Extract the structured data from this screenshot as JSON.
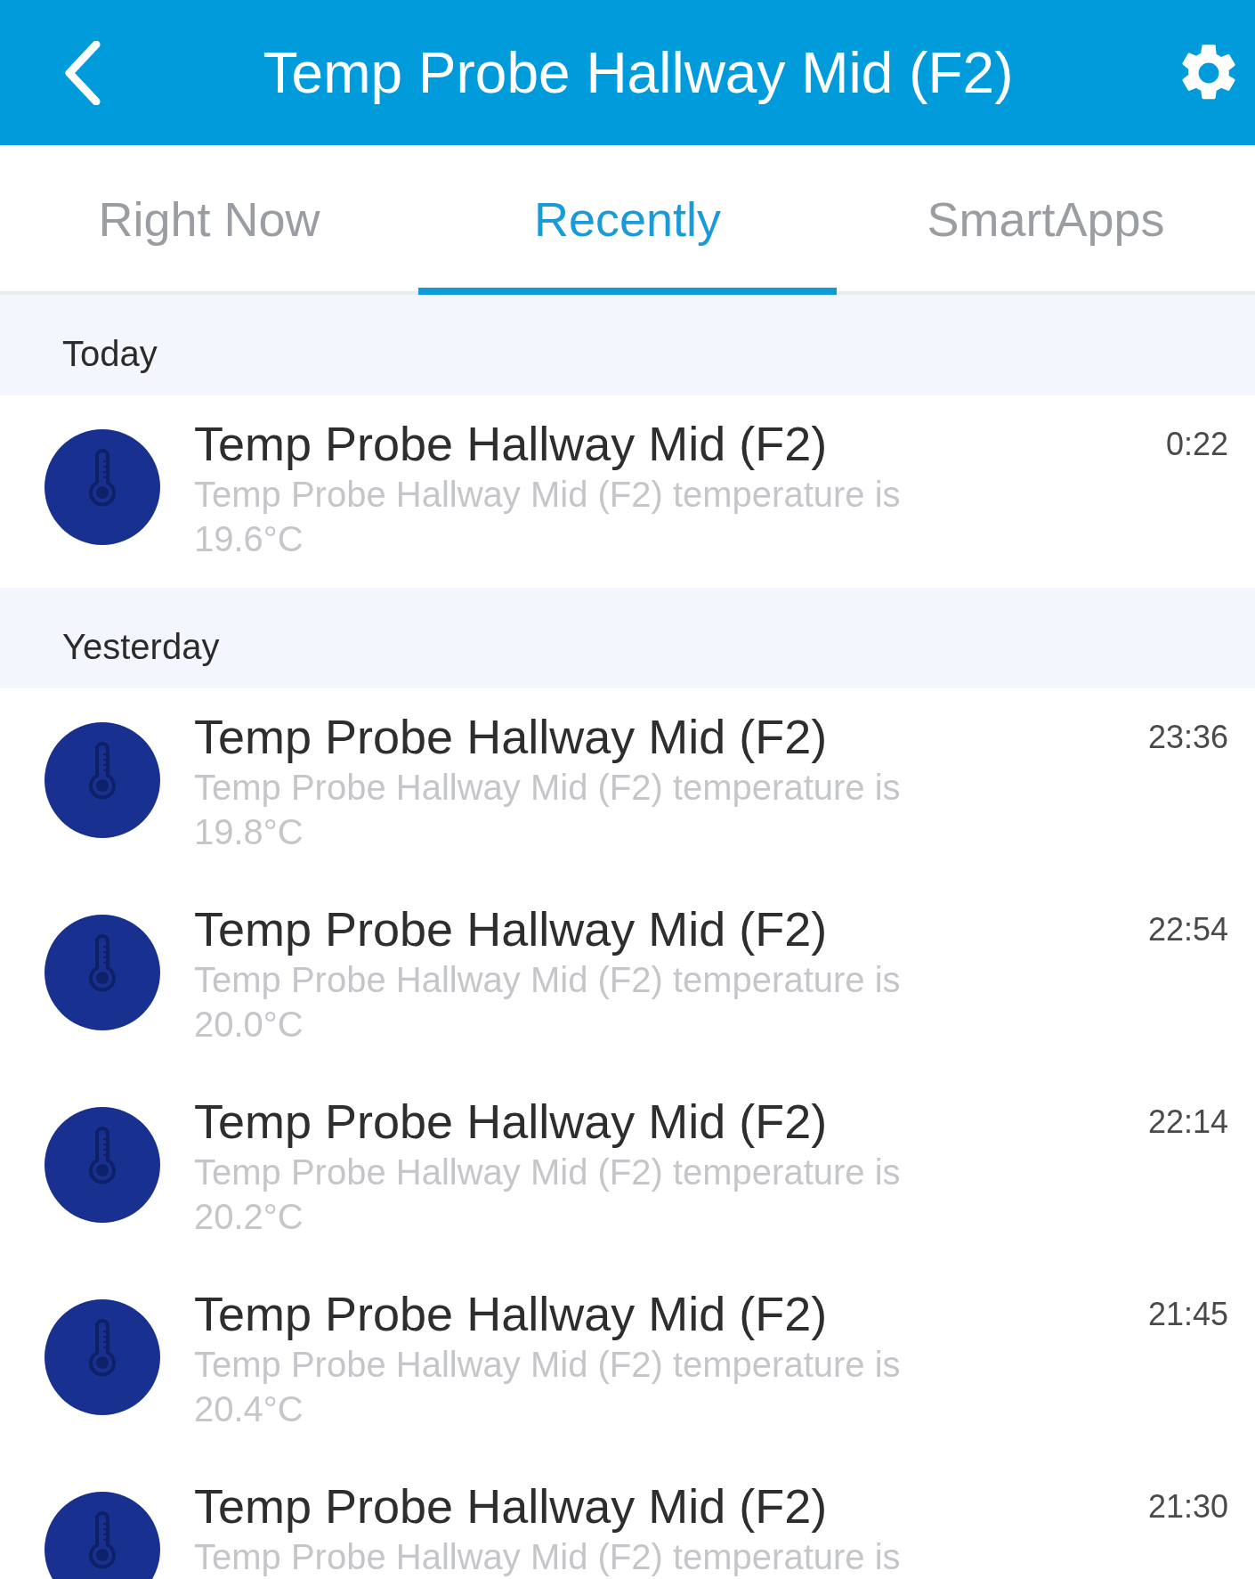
{
  "header": {
    "title": "Temp Probe Hallway Mid (F2)"
  },
  "tabs": [
    {
      "label": "Right Now",
      "selected": false
    },
    {
      "label": "Recently",
      "selected": true
    },
    {
      "label": "SmartApps",
      "selected": false
    }
  ],
  "sections": [
    {
      "heading": "Today",
      "events": [
        {
          "title": "Temp Probe Hallway Mid (F2)",
          "description": "Temp Probe Hallway Mid (F2) temperature is 19.6°C",
          "time": "0:22"
        }
      ]
    },
    {
      "heading": "Yesterday",
      "events": [
        {
          "title": "Temp Probe Hallway Mid (F2)",
          "description": "Temp Probe Hallway Mid (F2) temperature is 19.8°C",
          "time": "23:36"
        },
        {
          "title": "Temp Probe Hallway Mid (F2)",
          "description": "Temp Probe Hallway Mid (F2) temperature is 20.0°C",
          "time": "22:54"
        },
        {
          "title": "Temp Probe Hallway Mid (F2)",
          "description": "Temp Probe Hallway Mid (F2) temperature is 20.2°C",
          "time": "22:14"
        },
        {
          "title": "Temp Probe Hallway Mid (F2)",
          "description": "Temp Probe Hallway Mid (F2) temperature is 20.4°C",
          "time": "21:45"
        },
        {
          "title": "Temp Probe Hallway Mid (F2)",
          "description": "Temp Probe Hallway Mid (F2) temperature is",
          "time": "21:30"
        }
      ]
    }
  ]
}
